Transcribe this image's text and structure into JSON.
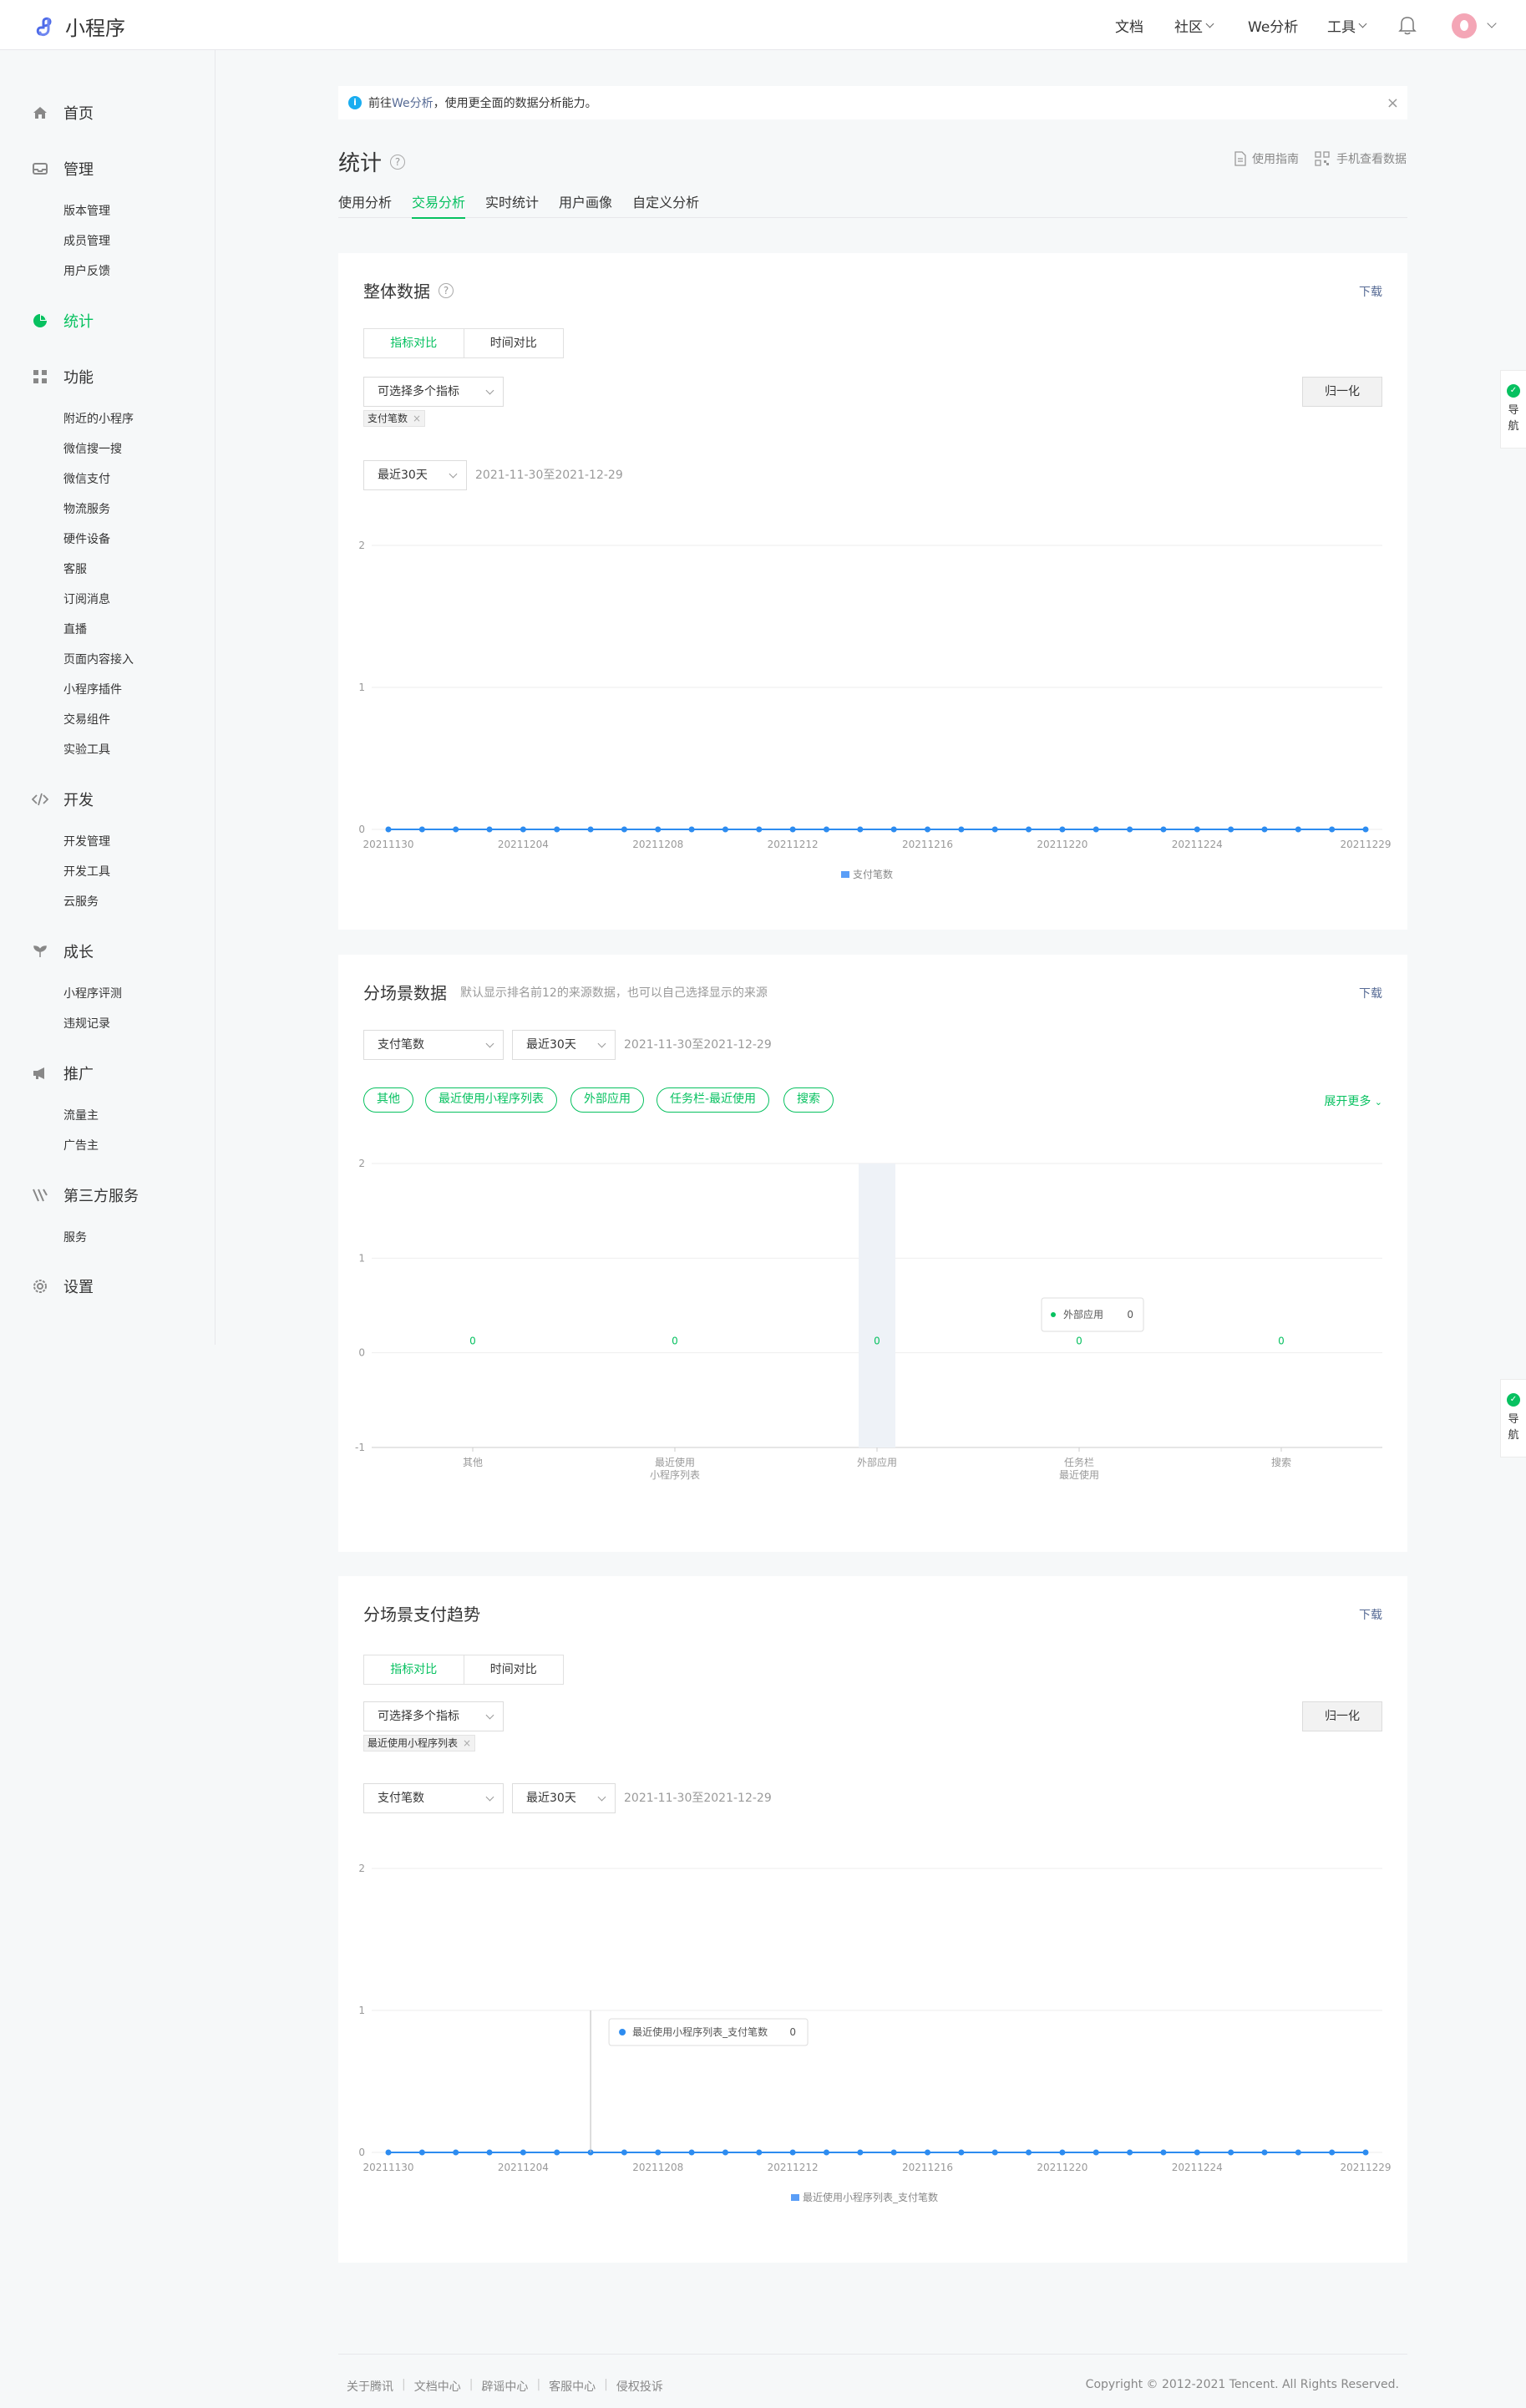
{
  "app": {
    "title": "小程序"
  },
  "topnav": {
    "docs": "文档",
    "community": "社区",
    "we_analysis": "We分析",
    "tools": "工具"
  },
  "sidebar": {
    "home": "首页",
    "manage": "管理",
    "manage_items": [
      "版本管理",
      "成员管理",
      "用户反馈"
    ],
    "stats": "统计",
    "features": "功能",
    "feature_items": [
      "附近的小程序",
      "微信搜一搜",
      "微信支付",
      "物流服务",
      "硬件设备",
      "客服",
      "订阅消息",
      "直播",
      "页面内容接入",
      "小程序插件",
      "交易组件",
      "实验工具"
    ],
    "dev": "开发",
    "dev_items": [
      "开发管理",
      "开发工具",
      "云服务"
    ],
    "growth": "成长",
    "growth_items": [
      "小程序评测",
      "违规记录"
    ],
    "promote": "推广",
    "promote_items": [
      "流量主",
      "广告主"
    ],
    "third": "第三方服务",
    "third_items": [
      "服务"
    ],
    "settings": "设置"
  },
  "notice": {
    "prefix": "前往",
    "link": "We分析",
    "suffix": "，使用更全面的数据分析能力。",
    "close": "×"
  },
  "page": {
    "title": "统计",
    "help": "?",
    "guide": "使用指南",
    "mobile": "手机查看数据"
  },
  "tabs": [
    "使用分析",
    "交易分析",
    "实时统计",
    "用户画像",
    "自定义分析"
  ],
  "float_nav": {
    "icon": "✓",
    "label1": "导",
    "label2": "航"
  },
  "card1": {
    "title": "整体数据",
    "help": "?",
    "download": "下载",
    "seg": [
      "指标对比",
      "时间对比"
    ],
    "multi_select": "可选择多个指标",
    "normalize": "归一化",
    "tag": "支付笔数",
    "tag_x": "×",
    "period": "最近30天",
    "daterange": "2021-11-30至2021-12-29",
    "legend": "支付笔数"
  },
  "card2": {
    "title": "分场景数据",
    "subtitle": "默认显示排名前12的来源数据，也可以自己选择显示的来源",
    "download": "下载",
    "metric": "支付笔数",
    "period": "最近30天",
    "daterange": "2021-11-30至2021-12-29",
    "pills": [
      "其他",
      "最近使用小程序列表",
      "外部应用",
      "任务栏-最近使用",
      "搜索"
    ],
    "expand": "展开更多",
    "tooltip_label": "外部应用",
    "tooltip_value": "0"
  },
  "card3": {
    "title": "分场景支付趋势",
    "download": "下载",
    "seg": [
      "指标对比",
      "时间对比"
    ],
    "multi_select": "可选择多个指标",
    "normalize": "归一化",
    "tag": "最近使用小程序列表",
    "tag_x": "×",
    "metric": "支付笔数",
    "period": "最近30天",
    "daterange": "2021-11-30至2021-12-29",
    "legend": "最近使用小程序列表_支付笔数",
    "tooltip_label": "最近使用小程序列表_支付笔数",
    "tooltip_value": "0"
  },
  "chart_data": [
    {
      "type": "line",
      "x_ticks": [
        "20211130",
        "20211204",
        "20211208",
        "20211212",
        "20211216",
        "20211220",
        "20211224",
        "20211229"
      ],
      "y_ticks": [
        "0",
        "1",
        "2"
      ],
      "ylim": [
        0,
        2
      ],
      "series": [
        {
          "name": "支付笔数",
          "values": [
            0,
            0,
            0,
            0,
            0,
            0,
            0,
            0,
            0,
            0,
            0,
            0,
            0,
            0,
            0,
            0,
            0,
            0,
            0,
            0,
            0,
            0,
            0,
            0,
            0,
            0,
            0,
            0,
            0,
            0
          ],
          "color": "#2d8cf0"
        }
      ]
    },
    {
      "type": "bar",
      "categories": [
        "其他",
        "最近使用\n小程序列表",
        "外部应用",
        "任务栏\n最近使用",
        "搜索"
      ],
      "values": [
        0,
        0,
        0,
        0,
        0
      ],
      "y_ticks": [
        "-1",
        "0",
        "1",
        "2"
      ],
      "ylim": [
        -1,
        2
      ]
    },
    {
      "type": "line",
      "x_ticks": [
        "20211130",
        "20211204",
        "20211208",
        "20211212",
        "20211216",
        "20211220",
        "20211224",
        "20211229"
      ],
      "y_ticks": [
        "0",
        "1",
        "2"
      ],
      "ylim": [
        0,
        2
      ],
      "series": [
        {
          "name": "最近使用小程序列表_支付笔数",
          "values": [
            0,
            0,
            0,
            0,
            0,
            0,
            0,
            0,
            0,
            0,
            0,
            0,
            0,
            0,
            0,
            0,
            0,
            0,
            0,
            0,
            0,
            0,
            0,
            0,
            0,
            0,
            0,
            0,
            0,
            0
          ],
          "color": "#2d8cf0"
        }
      ]
    }
  ],
  "footer": {
    "links": [
      "关于腾讯",
      "文档中心",
      "辟谣中心",
      "客服中心",
      "侵权投诉"
    ],
    "copyright": "Copyright © 2012-2021 Tencent. All Rights Reserved."
  }
}
